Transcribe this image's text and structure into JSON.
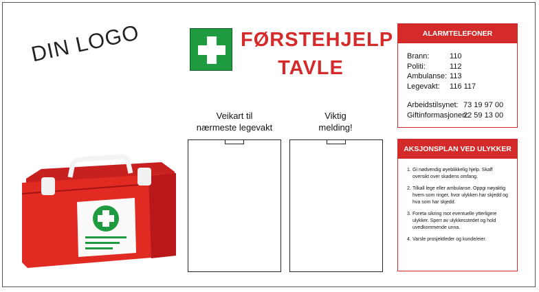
{
  "logo": {
    "text": "DIN LOGO"
  },
  "title": {
    "line1": "FØRSTEHJELP",
    "line2": "TAVLE"
  },
  "panels": [
    {
      "label_line1": "Veikart til",
      "label_line2": "nærmeste legevakt"
    },
    {
      "label_line1": "Viktig",
      "label_line2": "melding!"
    }
  ],
  "alarm": {
    "title": "ALARMTELEFONER",
    "rows": [
      {
        "name": "Brann:",
        "number": "110"
      },
      {
        "name": "Politi:",
        "number": "112"
      },
      {
        "name": "Ambulanse:",
        "number": "113"
      },
      {
        "name": "Legevakt:",
        "number": "116 117"
      }
    ],
    "extra": [
      {
        "name": "Arbeidstilsynet:",
        "number": "73 19 97 00"
      },
      {
        "name": "Giftinformasjonen:",
        "number": "22 59 13 00"
      }
    ]
  },
  "actionplan": {
    "title": "AKSJONSPLAN VED ULYKKER",
    "steps": [
      {
        "n": "1.",
        "text": "Gi nødvendig øyeblikkelig hjelp. Skaff oversikt over skadens omfang."
      },
      {
        "n": "2.",
        "text": "Tilkall lege eller ambulanse. Oppgi nøyaktig hvem som ringer, hvor ulykken har skjedd og hva som har skjedd."
      },
      {
        "n": "3.",
        "text": "Foreta sikring mot eventuelle ytterligere ulykker. Sperr av ulykkesstedet og hold uvedkommende unna."
      },
      {
        "n": "4.",
        "text": "Varsle prosjektleder og kunde/eier."
      }
    ]
  },
  "colors": {
    "accent": "#d42a2a",
    "green": "#1e9a3f"
  }
}
